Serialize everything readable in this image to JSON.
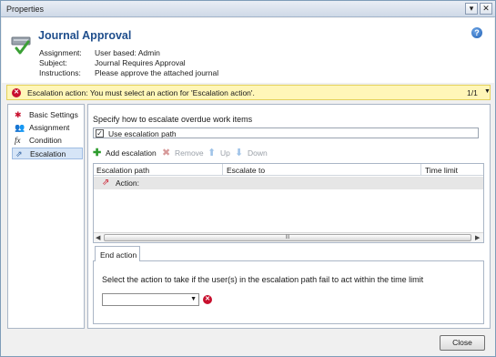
{
  "window": {
    "title": "Properties"
  },
  "header": {
    "title": "Journal Approval",
    "assignment_label": "Assignment:",
    "assignment_value": "User based: Admin",
    "subject_label": "Subject:",
    "subject_value": "Journal Requires Approval",
    "instructions_label": "Instructions:",
    "instructions_value": "Please approve the attached journal"
  },
  "warning": {
    "text": "Escalation action: You must select an action for 'Escalation action'.",
    "count": "1/1"
  },
  "nav": {
    "items": [
      {
        "label": "Basic Settings",
        "icon": "star-icon"
      },
      {
        "label": "Assignment",
        "icon": "people-icon"
      },
      {
        "label": "Condition",
        "icon": "function-icon"
      },
      {
        "label": "Escalation",
        "icon": "escalation-icon",
        "selected": true
      }
    ]
  },
  "content": {
    "heading": "Specify how to escalate overdue work items",
    "use_path_label": "Use escalation path",
    "use_path_checked": true,
    "toolbar": {
      "add": "Add escalation",
      "remove": "Remove",
      "up": "Up",
      "down": "Down"
    },
    "grid": {
      "columns": [
        "Escalation path",
        "Escalate to",
        "Time limit"
      ],
      "rows": [
        {
          "label": "Action:"
        }
      ],
      "scroll_marker": "III"
    },
    "tab": {
      "label": "End action",
      "instruction": "Select the action to take if the user(s) in the escalation path fail to act within the time limit",
      "select_value": ""
    }
  },
  "footer": {
    "close_label": "Close"
  },
  "colors": {
    "accent": "#1f4e8c",
    "warning_bg": "#fff6b8",
    "error": "#c8102e",
    "selected": "#d6e5f7"
  }
}
